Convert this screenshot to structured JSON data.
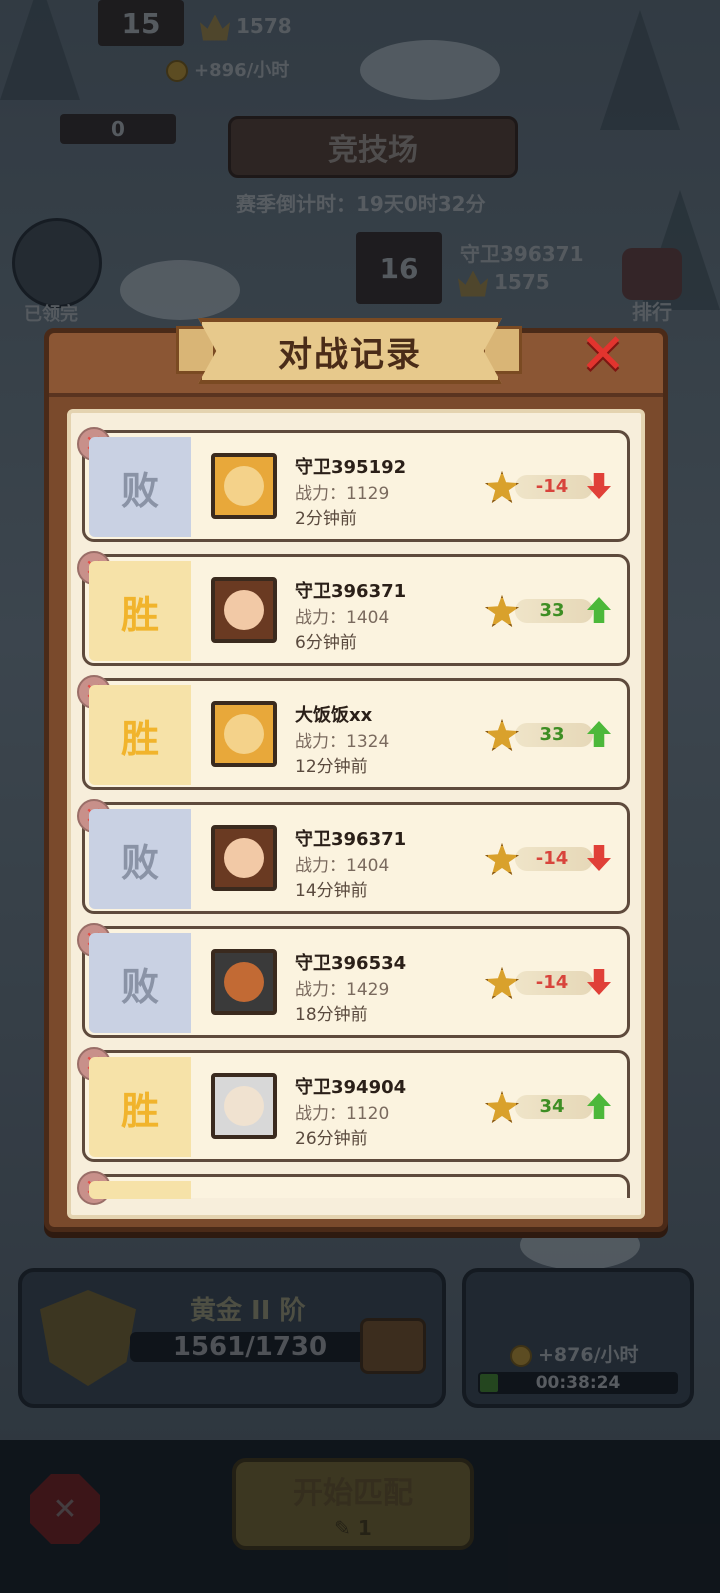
{
  "background": {
    "top_rank": "15",
    "top_score": "1578",
    "top_income": "+896/小时",
    "scroll_count": "0",
    "arena_title": "竞技场",
    "season_countdown": "赛季倒计时：19天0时32分",
    "rank_16": "16",
    "rank_16_name": "守卫396371",
    "rank_16_score": "1575",
    "claimed_label": "已领完",
    "ranking_label": "排行",
    "tier_name": "黄金 II 阶",
    "tier_progress": "1561/1730",
    "idle_rate": "+876/小时",
    "idle_timer": "00:38:24",
    "match_button": "开始匹配",
    "match_ticket_count": "1"
  },
  "dialog": {
    "title": "对战记录",
    "close_icon": "close-x-icon"
  },
  "records": [
    {
      "result": "败",
      "name": "守卫395192",
      "power": "战力：1129",
      "ago": "2分钟前",
      "delta": "-14",
      "outcome": "lose",
      "avatar": "golden-helmet-hero"
    },
    {
      "result": "胜",
      "name": "守卫396371",
      "power": "战力：1404",
      "ago": "6分钟前",
      "delta": "33",
      "outcome": "win",
      "avatar": "brown-hair-hero"
    },
    {
      "result": "胜",
      "name": "大饭饭xx",
      "power": "战力：1324",
      "ago": "12分钟前",
      "delta": "33",
      "outcome": "win",
      "avatar": "golden-helmet-hero"
    },
    {
      "result": "败",
      "name": "守卫396371",
      "power": "战力：1404",
      "ago": "14分钟前",
      "delta": "-14",
      "outcome": "lose",
      "avatar": "brown-hair-hero"
    },
    {
      "result": "败",
      "name": "守卫396534",
      "power": "战力：1429",
      "ago": "18分钟前",
      "delta": "-14",
      "outcome": "lose",
      "avatar": "dark-helmet-hero"
    },
    {
      "result": "胜",
      "name": "守卫394904",
      "power": "战力：1120",
      "ago": "26分钟前",
      "delta": "34",
      "outcome": "win",
      "avatar": "white-beard-hero"
    }
  ],
  "colors": {
    "win_text": "#f1b42c",
    "lose_text": "#8a93a6",
    "delta_win": "#3e8e24",
    "delta_lose": "#d8443c"
  }
}
